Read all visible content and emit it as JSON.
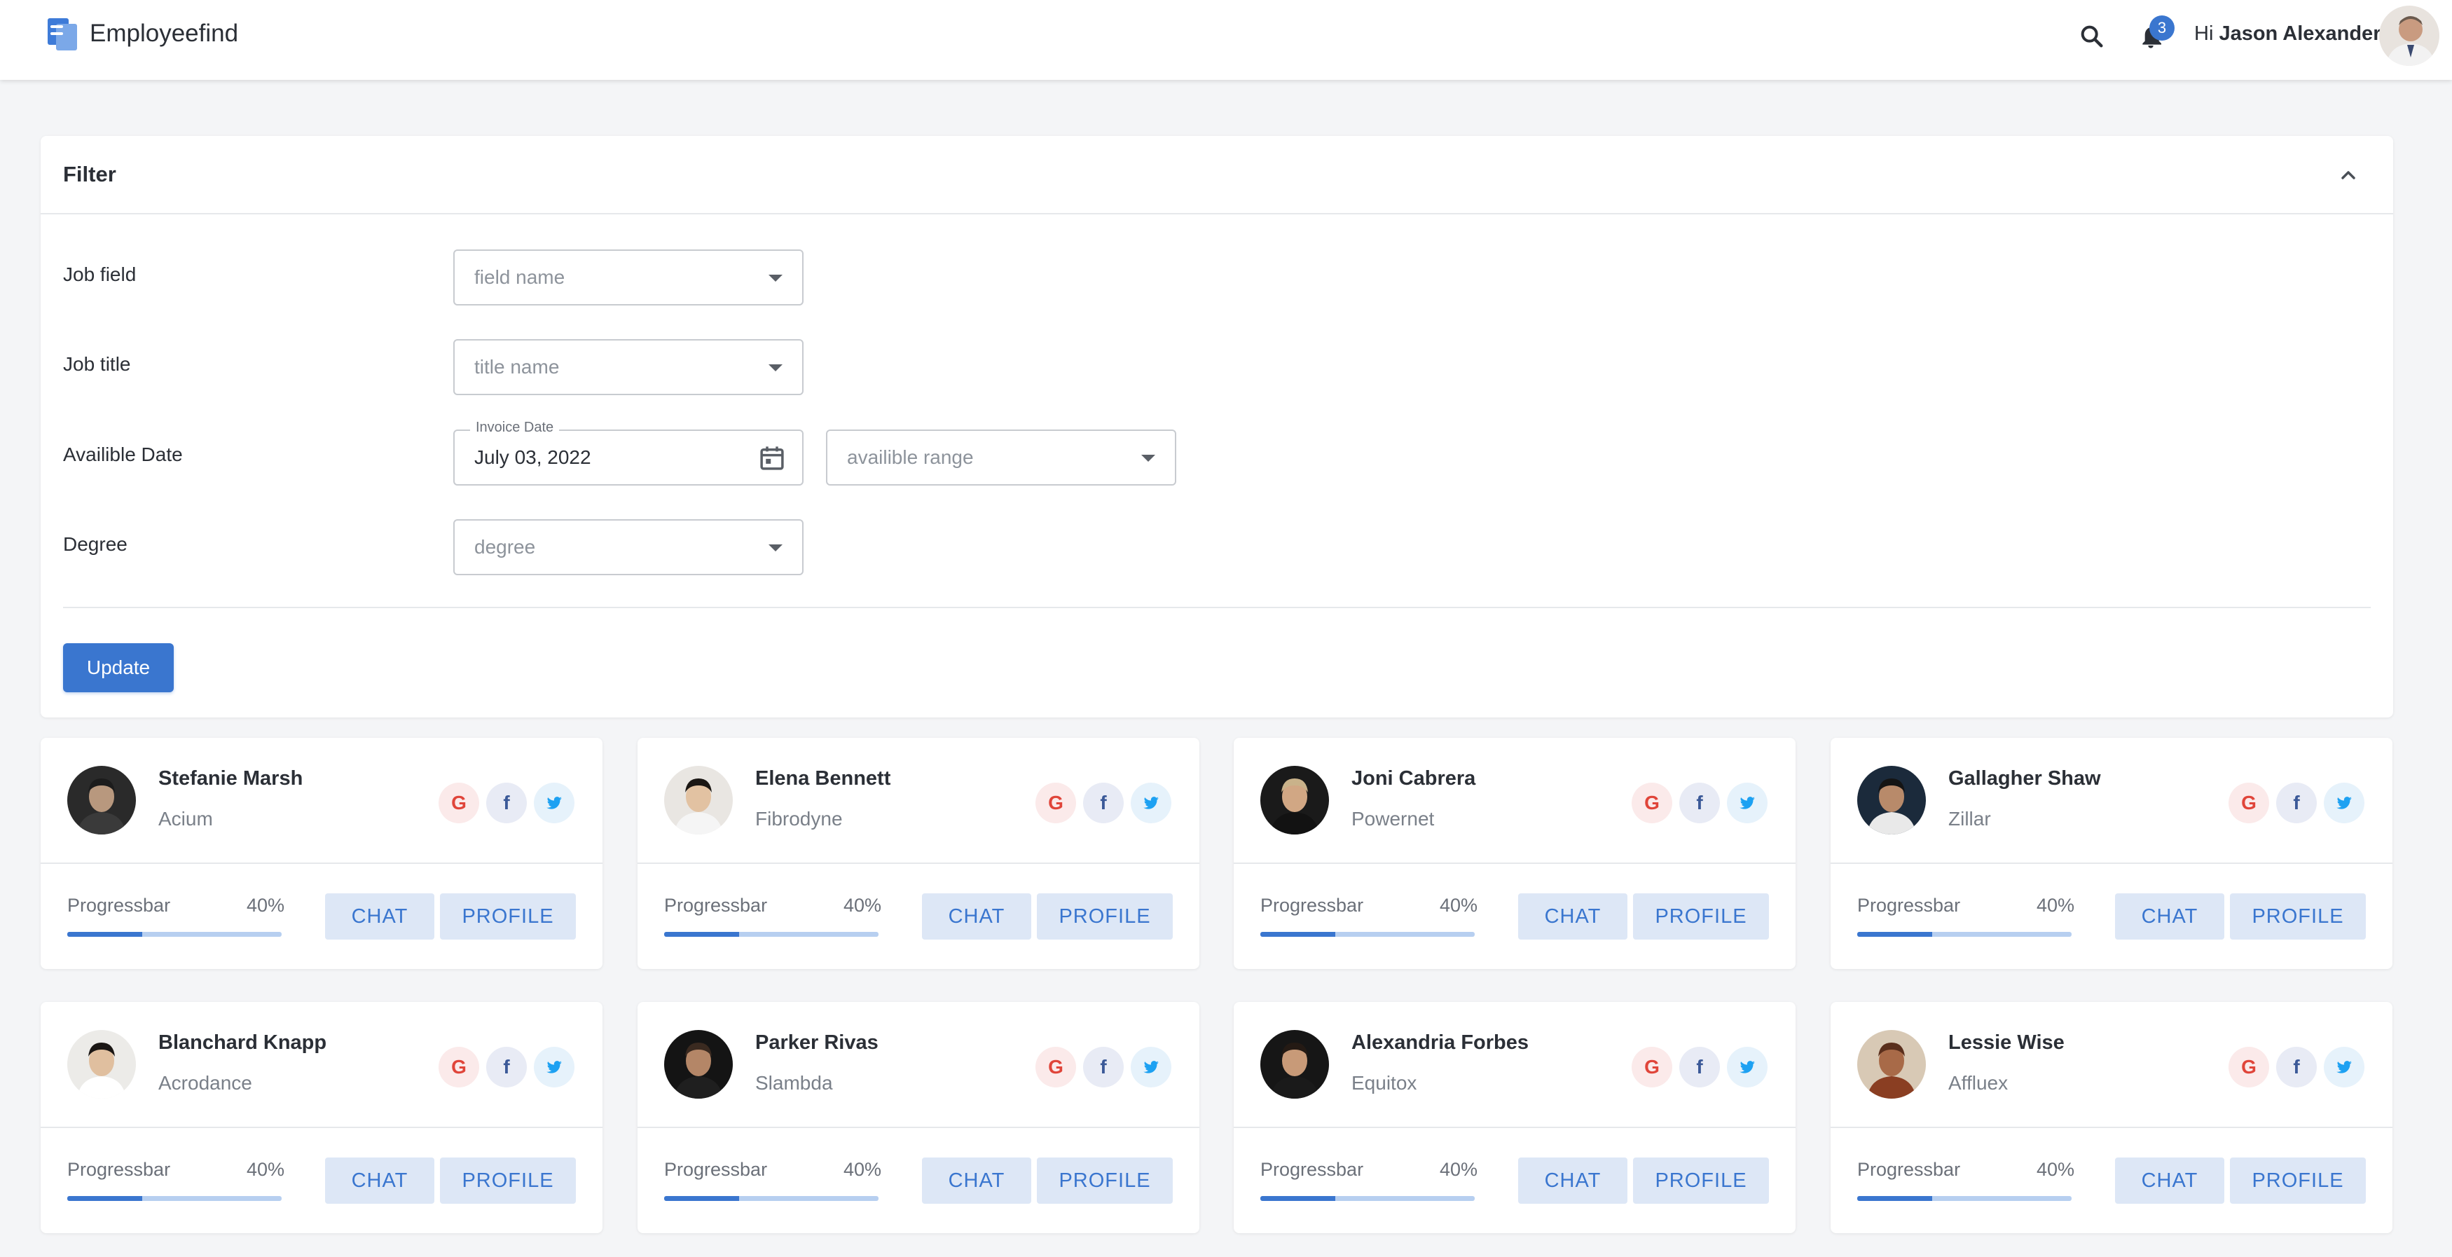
{
  "app": {
    "name": "Employeefind",
    "logo_icon": "document-stack-icon"
  },
  "header": {
    "search_icon": "search-icon",
    "notifications": {
      "icon": "bell-icon",
      "count": "3"
    },
    "greeting_prefix": "Hi",
    "user_name": "Jason Alexander"
  },
  "filter": {
    "title": "Filter",
    "collapse_icon": "chevron-up-icon",
    "rows": {
      "job_field": {
        "label": "Job field",
        "placeholder": "field name"
      },
      "job_title": {
        "label": "Job title",
        "placeholder": "title name"
      },
      "available_date": {
        "label": "Availible Date",
        "date_label": "Invoice Date",
        "date_value": "July 03, 2022",
        "range_placeholder": "availible range"
      },
      "degree": {
        "label": "Degree",
        "placeholder": "degree"
      }
    },
    "update_label": "Update"
  },
  "card_labels": {
    "progress": "Progressbar",
    "chat": "CHAT",
    "profile": "PROFILE"
  },
  "employees": [
    {
      "name": "Stefanie Marsh",
      "company": "Acium",
      "progress": "40%",
      "progress_value": 0.35
    },
    {
      "name": "Elena Bennett",
      "company": "Fibrodyne",
      "progress": "40%",
      "progress_value": 0.35
    },
    {
      "name": "Joni Cabrera",
      "company": "Powernet",
      "progress": "40%",
      "progress_value": 0.35
    },
    {
      "name": "Gallagher Shaw",
      "company": "Zillar",
      "progress": "40%",
      "progress_value": 0.35
    },
    {
      "name": "Blanchard Knapp",
      "company": "Acrodance",
      "progress": "40%",
      "progress_value": 0.35
    },
    {
      "name": "Parker Rivas",
      "company": "Slambda",
      "progress": "40%",
      "progress_value": 0.35
    },
    {
      "name": "Alexandria Forbes",
      "company": "Equitox",
      "progress": "40%",
      "progress_value": 0.35
    },
    {
      "name": "Lessie Wise",
      "company": "Affluex",
      "progress": "40%",
      "progress_value": 0.35
    }
  ],
  "colors": {
    "accent": "#3a76cf",
    "google": "#e0453a",
    "facebook": "#3b5998",
    "twitter": "#1da1f2"
  }
}
